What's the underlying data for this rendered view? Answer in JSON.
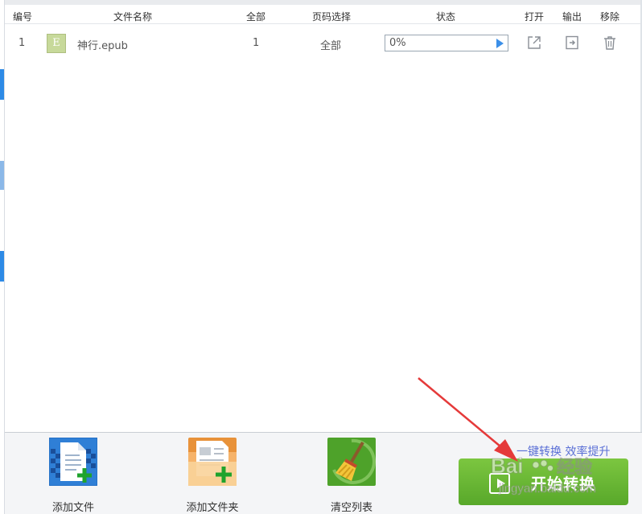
{
  "header": {
    "col_index": "编号",
    "col_filename": "文件名称",
    "col_all": "全部",
    "col_page_select": "页码选择",
    "col_status": "状态",
    "col_open": "打开",
    "col_output": "输出",
    "col_remove": "移除"
  },
  "files": [
    {
      "index": "1",
      "type_letter": "E",
      "name": "神行.epub",
      "total": "1",
      "page_select": "全部",
      "progress_text": "0%",
      "progress_fraction": 0
    }
  ],
  "toolbar": {
    "add_file": "添加文件",
    "add_folder": "添加文件夹",
    "clear_list": "清空列表"
  },
  "promo": {
    "slogan": "一键转换 效率提升",
    "start_label": "开始转换"
  },
  "watermark": {
    "brand_text": "Bai 经验",
    "url": "jingyan.baidu.com"
  },
  "colors": {
    "accent_blue": "#2d8ae6",
    "start_green": "#6cbf36",
    "annotation_red": "#e53a3a",
    "slogan_blue": "#5a6fd6"
  },
  "icons": {
    "file_type": "epub-icon",
    "open": "open-external-icon",
    "output": "output-export-icon",
    "remove": "trash-icon",
    "add_file": "add-file-icon",
    "add_folder": "add-folder-icon",
    "clear_list": "broom-icon",
    "start": "play-icon"
  }
}
